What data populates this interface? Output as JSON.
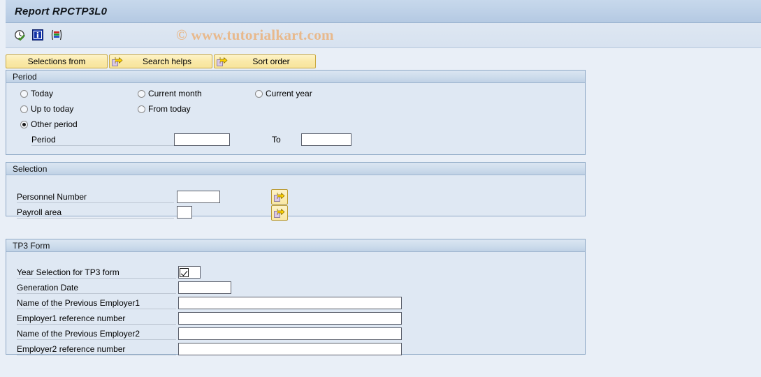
{
  "window": {
    "title": "Report RPCTP3L0",
    "watermark": "© www.tutorialkart.com"
  },
  "toolbar": {
    "icons": [
      {
        "name": "execute-clock-check-icon",
        "title": "Execute"
      },
      {
        "name": "info-icon",
        "title": "Information"
      },
      {
        "name": "variant-icon",
        "title": "Variants"
      }
    ]
  },
  "buttons": [
    {
      "name": "selections-from-button",
      "label": "Selections from",
      "icon": null
    },
    {
      "name": "search-helps-button",
      "label": "Search helps",
      "icon": "arrow-page-icon"
    },
    {
      "name": "sort-order-button",
      "label": "Sort order",
      "icon": "arrow-page-icon"
    }
  ],
  "period": {
    "title": "Period",
    "options": [
      {
        "label": "Today",
        "selected": false
      },
      {
        "label": "Current month",
        "selected": false
      },
      {
        "label": "Current year",
        "selected": false
      },
      {
        "label": "Up to today",
        "selected": false
      },
      {
        "label": "From today",
        "selected": false
      },
      {
        "label": "Other period",
        "selected": true
      }
    ],
    "period_label": "Period",
    "period_value": "",
    "to_label": "To",
    "to_value": ""
  },
  "selection": {
    "title": "Selection",
    "rows": [
      {
        "label": "Personnel Number",
        "value": "",
        "has_arrow": true
      },
      {
        "label": "Payroll area",
        "value": "",
        "has_arrow": true
      }
    ]
  },
  "tp3": {
    "title": "TP3 Form",
    "year_selection_label": "Year Selection for TP3 form",
    "year_selection_checked": true,
    "rows": [
      {
        "label": "Generation Date",
        "value": ""
      },
      {
        "label": "Name of the Previous  Employer1",
        "value": ""
      },
      {
        "label": "Employer1 reference number",
        "value": ""
      },
      {
        "label": "Name of the Previous  Employer2",
        "value": ""
      },
      {
        "label": "Employer2 reference number",
        "value": ""
      }
    ]
  },
  "colors": {
    "page_bg": "#e9eff7",
    "group_bg": "#dfe8f3",
    "group_border": "#8fa9c6",
    "title_bar": "#bfd2e8",
    "button_yellow": "#faeaa8",
    "watermark": "#e8b98c"
  }
}
